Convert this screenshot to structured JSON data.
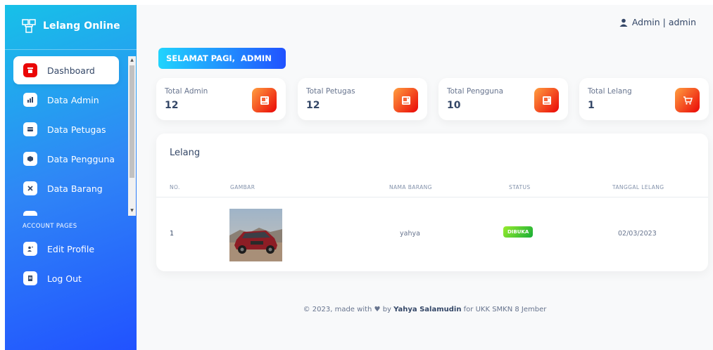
{
  "sidebar": {
    "brand": "Lelang Online",
    "nav_items": [
      {
        "label": "Dashboard",
        "icon": "store-icon"
      },
      {
        "label": "Data Admin",
        "icon": "chart-icon"
      },
      {
        "label": "Data Petugas",
        "icon": "card-icon"
      },
      {
        "label": "Data Pengguna",
        "icon": "box-icon"
      },
      {
        "label": "Data Barang",
        "icon": "tools-icon"
      }
    ],
    "section_label": "ACCOUNT PAGES",
    "account_items": [
      {
        "label": "Edit Profile",
        "icon": "profile-icon"
      },
      {
        "label": "Log Out",
        "icon": "document-icon"
      }
    ]
  },
  "header": {
    "user": "Admin | admin"
  },
  "greeting": "SELAMAT PAGI,  ADMIN",
  "stats": [
    {
      "label": "Total Admin",
      "value": "12",
      "icon": "contact-card-icon"
    },
    {
      "label": "Total Petugas",
      "value": "12",
      "icon": "contact-card-icon"
    },
    {
      "label": "Total Pengguna",
      "value": "10",
      "icon": "contact-card-icon"
    },
    {
      "label": "Total Lelang",
      "value": "1",
      "icon": "cart-icon"
    }
  ],
  "table": {
    "title": "Lelang",
    "headers": [
      "NO.",
      "GAMBAR",
      "NAMA BARANG",
      "STATUS",
      "TANGGAL LELANG"
    ],
    "rows": [
      {
        "no": "1",
        "nama_barang": "yahya",
        "status": "DIBUKA",
        "tanggal": "02/03/2023"
      }
    ]
  },
  "footer": {
    "prefix": "© 2023, made with",
    "by": "by",
    "author": "Yahya Salamudin",
    "suffix": "for UKK SMKN 8 Jember"
  },
  "colors": {
    "sidebar_start": "#17c1e8",
    "sidebar_end": "#2152ff",
    "icon_gradient_start": "#ea0606",
    "icon_gradient_end": "#ff9f40",
    "badge_green": "#17ad37"
  }
}
